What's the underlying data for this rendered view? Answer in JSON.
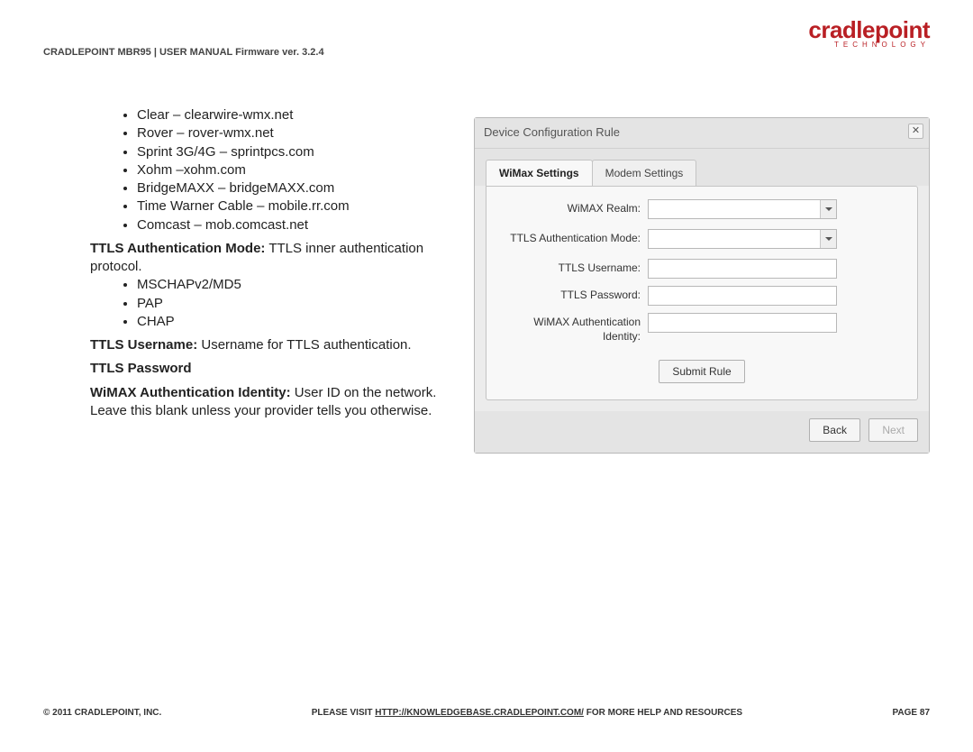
{
  "logo": {
    "main": "cradlepoint",
    "sub": "TECHNOLOGY"
  },
  "header": "CRADLEPOINT MBR95 | USER MANUAL Firmware ver. 3.2.4",
  "bullets_top": [
    "Clear – clearwire-wmx.net",
    "Rover – rover-wmx.net",
    "Sprint 3G/4G – sprintpcs.com",
    "Xohm –xohm.com",
    "BridgeMAXX – bridgeMAXX.com",
    "Time Warner Cable – mobile.rr.com",
    "Comcast – mob.comcast.net"
  ],
  "ttls_mode": {
    "label": "TTLS Authentication Mode:",
    "desc": " TTLS inner authentication protocol.",
    "items": [
      "MSCHAPv2/MD5",
      "PAP",
      "CHAP"
    ]
  },
  "ttls_user": {
    "label": "TTLS Username:",
    "desc": " Username for TTLS authentication."
  },
  "ttls_pass": {
    "label": "TTLS Password"
  },
  "wimax_auth": {
    "label": "WiMAX Authentication Identity:",
    "desc": " User ID on the network. Leave this blank unless your provider tells you otherwise."
  },
  "dialog": {
    "title": "Device Configuration Rule",
    "tabs": {
      "active": "WiMax Settings",
      "other": "Modem Settings"
    },
    "fields": {
      "realm": "WiMAX Realm:",
      "mode": "TTLS Authentication Mode:",
      "user": "TTLS Username:",
      "pass": "TTLS Password:",
      "ident": "WiMAX Authentication Identity:"
    },
    "submit": "Submit Rule",
    "back": "Back",
    "next": "Next",
    "close": "✕"
  },
  "footer": {
    "left": "© 2011 CRADLEPOINT, INC.",
    "mid_pre": "PLEASE VISIT ",
    "mid_link": "HTTP://KNOWLEDGEBASE.CRADLEPOINT.COM/",
    "mid_post": " FOR MORE HELP AND RESOURCES",
    "right": "PAGE 87"
  }
}
